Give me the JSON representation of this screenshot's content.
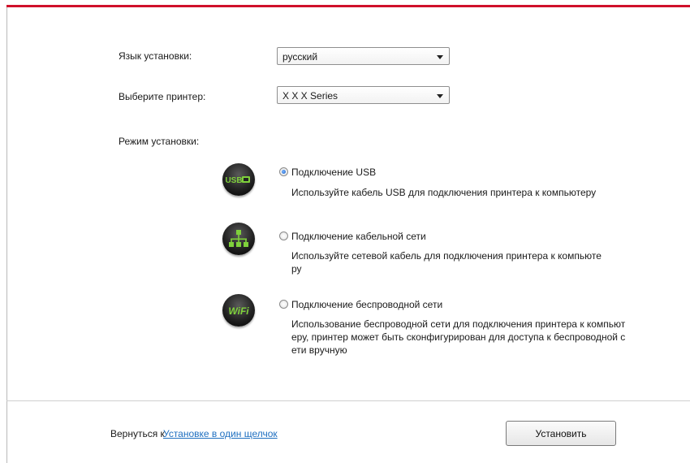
{
  "form": {
    "language_label": "Язык установки:",
    "language_value": "русский",
    "printer_label": "Выберите принтер:",
    "printer_value": "X X X Series",
    "mode_label": "Режим установки:"
  },
  "options": [
    {
      "title": "Подключение USB",
      "desc": [
        "Используйте кабель USB для подключения принтера к компьютеру"
      ],
      "icon": "usb-icon",
      "icon_text": "USB",
      "selected": true
    },
    {
      "title": "Подключение кабельной сети",
      "desc": [
        "Используйте сетевой кабель для подключения принтера к компьюте",
        "ру"
      ],
      "icon": "wired-network-icon",
      "selected": false
    },
    {
      "title": "Подключение беспроводной сети",
      "desc": [
        "Использование беспроводной сети для подключения принтера к компьют",
        "еру, принтер может быть сконфигурирован для доступа к беспроводной с",
        "ети вручную"
      ],
      "icon": "wifi-icon",
      "icon_text": "WiFi",
      "selected": false
    }
  ],
  "footer": {
    "back_text": "Вернуться к",
    "back_link": "Установке в один щелчок",
    "install_label": "Установить"
  },
  "colors": {
    "accent_bar": "#d0102a",
    "link": "#1e6fc0",
    "icon_green": "#7fd13b"
  }
}
